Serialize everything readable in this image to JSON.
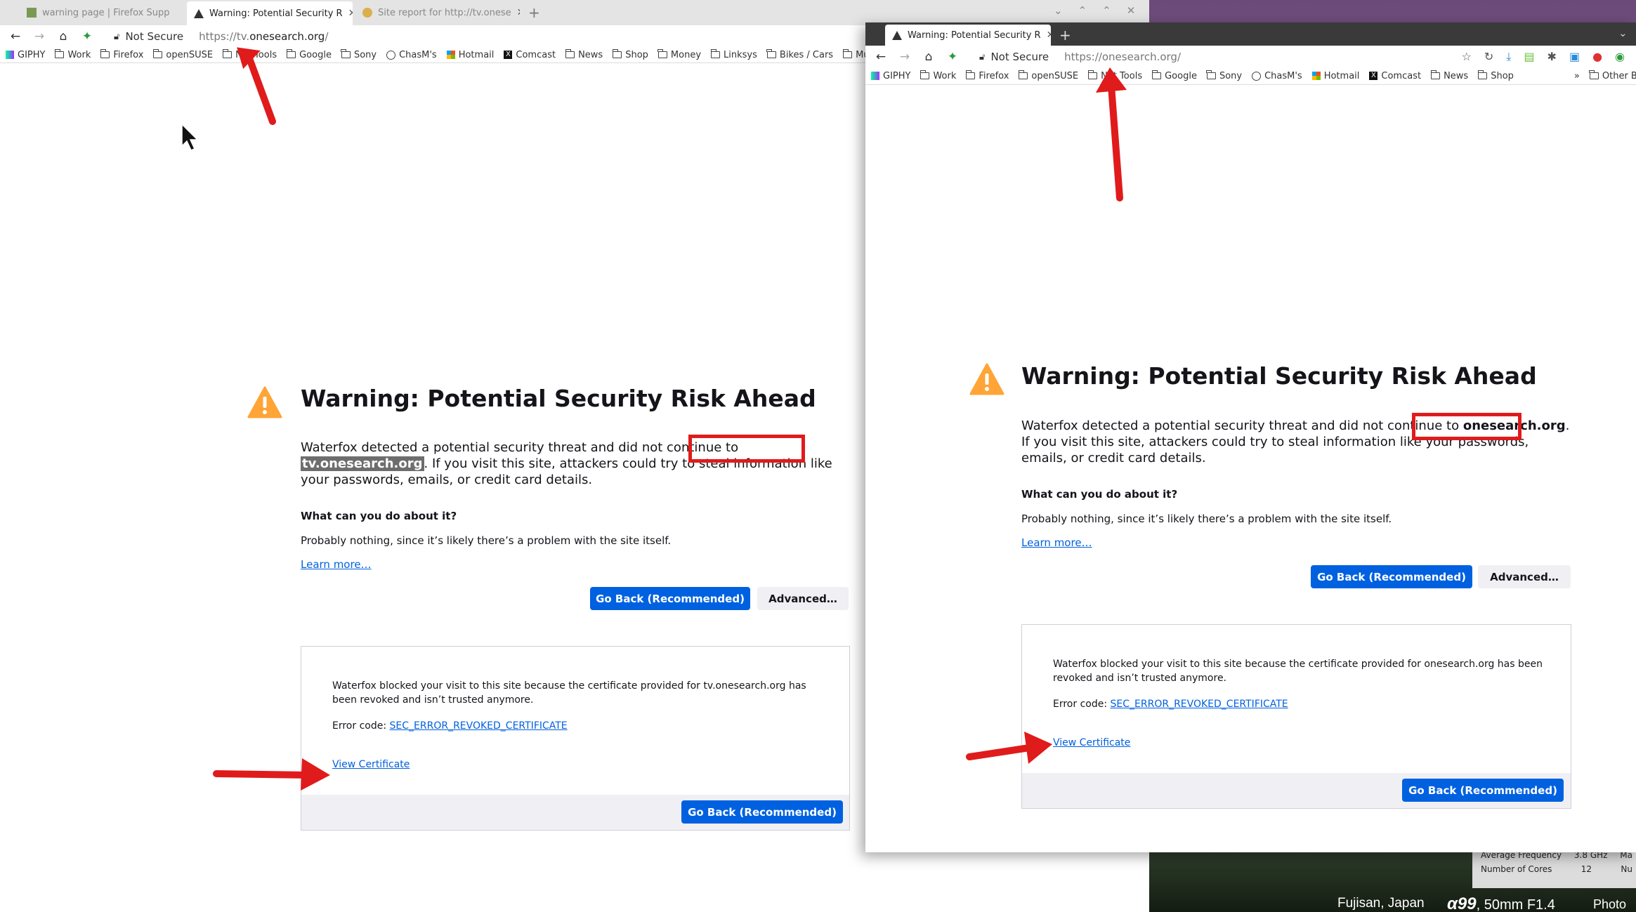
{
  "desktop": {
    "location": "Fujisan, Japan",
    "camera_model": "α99",
    "camera_lens": ", 50mm F1.4",
    "photo_label": "Photo",
    "sysinfo": [
      {
        "label": "Average Frequency",
        "value": "3.8 GHz",
        "extra": "Ma"
      },
      {
        "label": "Number of Cores",
        "value": "12",
        "extra": "Nu"
      }
    ]
  },
  "window1": {
    "tabs": [
      {
        "label": "warning page | Firefox Supp",
        "active": false
      },
      {
        "label": "Warning: Potential Security R",
        "active": true
      },
      {
        "label": "Site report for http://tv.onese",
        "active": false
      }
    ],
    "security_label": "Not Secure",
    "url_prefix": "https://tv.",
    "url_host": "onesearch.org",
    "url_suffix": "/",
    "bookmarks": [
      "GIPHY",
      "Work",
      "Firefox",
      "openSUSE",
      "Net Tools",
      "Google",
      "Sony",
      "ChasM's",
      "Hotmail",
      "Comcast",
      "News",
      "Shop",
      "Money",
      "Linksys",
      "Bikes / Cars",
      "Music"
    ],
    "title": "Warning: Potential Security Risk Ahead",
    "desc_before": "Waterfox detected a potential security threat and did not continue to ",
    "desc_host": "tv.onesearch.org",
    "desc_after": ". If you visit this site, attackers could try to steal information like your passwords, emails, or credit card details.",
    "what_heading": "What can you do about it?",
    "what_text": "Probably nothing, since it’s likely there’s a problem with the site itself.",
    "learn_more": "Learn more…",
    "go_back": "Go Back (Recommended)",
    "advanced": "Advanced…",
    "adv_text": "Waterfox blocked your visit to this site because the certificate provided for tv.onesearch.org has been revoked and isn’t trusted anymore.",
    "error_code_label": "Error code: ",
    "error_code": "SEC_ERROR_REVOKED_CERTIFICATE",
    "view_certificate": "View Certificate",
    "go_back_2": "Go Back (Recommended)"
  },
  "window2": {
    "tabs": [
      {
        "label": "Warning: Potential Security R",
        "active": true
      }
    ],
    "security_label": "Not Secure",
    "url_prefix": "https://",
    "url_host": "onesearch.org",
    "url_suffix": "/",
    "bookmarks": [
      "GIPHY",
      "Work",
      "Firefox",
      "openSUSE",
      "Net Tools",
      "Google",
      "Sony",
      "ChasM's",
      "Hotmail",
      "Comcast",
      "News",
      "Shop"
    ],
    "other_bookmarks": "Other Bookmar",
    "title": "Warning: Potential Security Risk Ahead",
    "desc_before": "Waterfox detected a potential security threat and did not continue to ",
    "desc_host": "onesearch.org",
    "desc_after": ". If you visit this site, attackers could try to steal information like your passwords, emails, or credit card details.",
    "what_heading": "What can you do about it?",
    "what_text": "Probably nothing, since it’s likely there’s a problem with the site itself.",
    "learn_more": "Learn more…",
    "go_back": "Go Back (Recommended)",
    "advanced": "Advanced…",
    "adv_text": "Waterfox blocked your visit to this site because the certificate provided for onesearch.org has been revoked and isn’t trusted anymore.",
    "error_code_label": "Error code: ",
    "error_code": "SEC_ERROR_REVOKED_CERTIFICATE",
    "view_certificate": "View Certificate",
    "go_back_2": "Go Back (Recommended)"
  },
  "colors": {
    "primary_button": "#0061e0",
    "link": "#0060df",
    "annotation_red": "#e01b1b",
    "warning_orange": "#ffa436"
  }
}
